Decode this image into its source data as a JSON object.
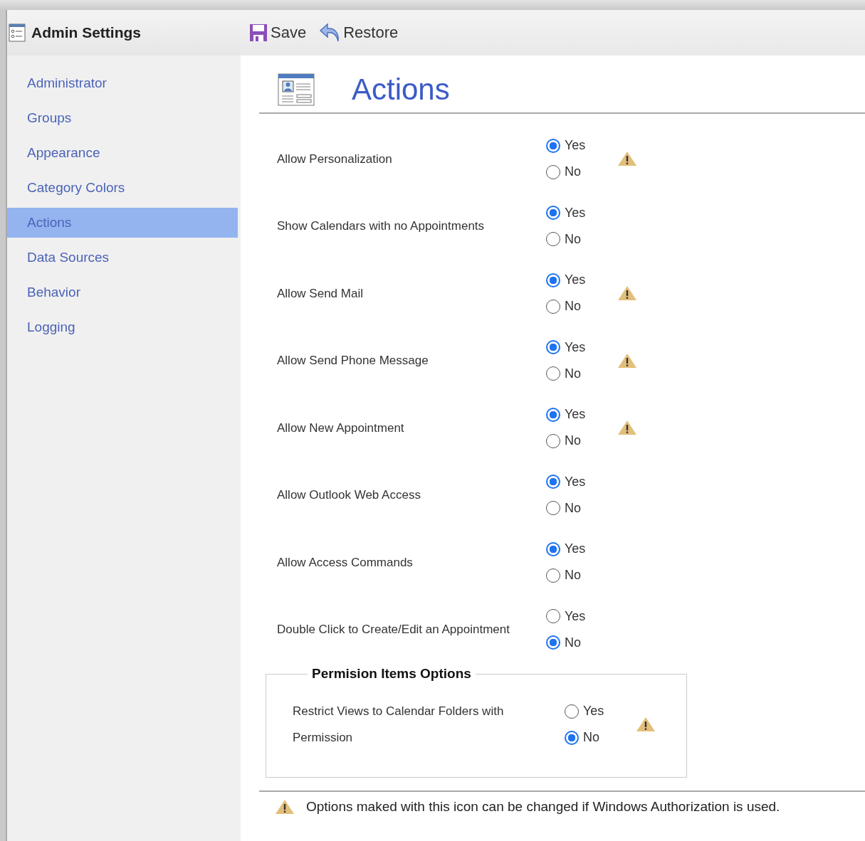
{
  "window": {
    "title": "Admin Settings"
  },
  "toolbar": [
    {
      "kind": "save",
      "label": "Save"
    },
    {
      "kind": "restore",
      "label": "Restore"
    }
  ],
  "sidebar": {
    "items": [
      {
        "label": "Administrator",
        "selected": false
      },
      {
        "label": "Groups",
        "selected": false
      },
      {
        "label": "Appearance",
        "selected": false
      },
      {
        "label": "Category Colors",
        "selected": false
      },
      {
        "label": "Actions",
        "selected": true
      },
      {
        "label": "Data Sources",
        "selected": false
      },
      {
        "label": "Behavior",
        "selected": false
      },
      {
        "label": "Logging",
        "selected": false
      }
    ]
  },
  "page": {
    "title": "Actions"
  },
  "options": [
    {
      "label": "Allow Personalization",
      "warning": true,
      "choices": [
        {
          "label": "Yes",
          "selected": true
        },
        {
          "label": "No",
          "selected": false
        }
      ]
    },
    {
      "label": "Show Calendars with no Appointments",
      "warning": false,
      "choices": [
        {
          "label": "Yes",
          "selected": true
        },
        {
          "label": "No",
          "selected": false
        }
      ]
    },
    {
      "label": "Allow Send Mail",
      "warning": true,
      "choices": [
        {
          "label": "Yes",
          "selected": true
        },
        {
          "label": "No",
          "selected": false
        }
      ]
    },
    {
      "label": "Allow Send Phone Message",
      "warning": true,
      "choices": [
        {
          "label": "Yes",
          "selected": true
        },
        {
          "label": "No",
          "selected": false
        }
      ]
    },
    {
      "label": "Allow New Appointment",
      "warning": true,
      "choices": [
        {
          "label": "Yes",
          "selected": true
        },
        {
          "label": "No",
          "selected": false
        }
      ]
    },
    {
      "label": "Allow Outlook Web Access",
      "warning": false,
      "choices": [
        {
          "label": "Yes",
          "selected": true
        },
        {
          "label": "No",
          "selected": false
        }
      ]
    },
    {
      "label": "Allow Access Commands",
      "warning": false,
      "choices": [
        {
          "label": "Yes",
          "selected": true
        },
        {
          "label": "No",
          "selected": false
        }
      ]
    },
    {
      "label": "Double Click to Create/Edit an Appointment",
      "warning": false,
      "choices": [
        {
          "label": "Yes",
          "selected": false
        },
        {
          "label": "No",
          "selected": true
        }
      ]
    }
  ],
  "permission_group": {
    "title": "Permision Items Options",
    "options": [
      {
        "label": "Restrict Views to Calendar Folders with Permission",
        "warning": true,
        "choices": [
          {
            "label": "Yes",
            "selected": false
          },
          {
            "label": "No",
            "selected": true
          }
        ]
      }
    ]
  },
  "footer_note": "Options maked with this icon can be changed if Windows Authorization is used."
}
